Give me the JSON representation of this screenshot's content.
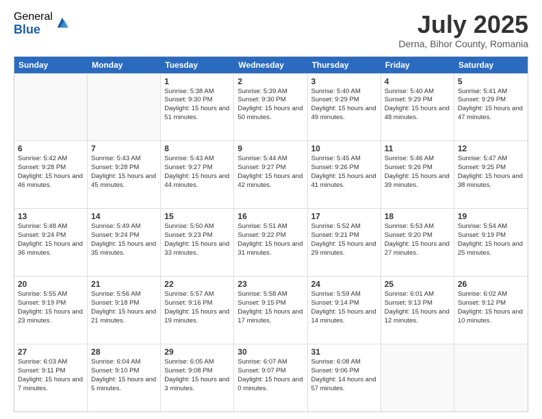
{
  "logo": {
    "general": "General",
    "blue": "Blue"
  },
  "header": {
    "month": "July 2025",
    "location": "Derna, Bihor County, Romania"
  },
  "weekdays": [
    "Sunday",
    "Monday",
    "Tuesday",
    "Wednesday",
    "Thursday",
    "Friday",
    "Saturday"
  ],
  "rows": [
    [
      {
        "day": "",
        "sunrise": "",
        "sunset": "",
        "daylight": ""
      },
      {
        "day": "",
        "sunrise": "",
        "sunset": "",
        "daylight": ""
      },
      {
        "day": "1",
        "sunrise": "Sunrise: 5:38 AM",
        "sunset": "Sunset: 9:30 PM",
        "daylight": "Daylight: 15 hours and 51 minutes."
      },
      {
        "day": "2",
        "sunrise": "Sunrise: 5:39 AM",
        "sunset": "Sunset: 9:30 PM",
        "daylight": "Daylight: 15 hours and 50 minutes."
      },
      {
        "day": "3",
        "sunrise": "Sunrise: 5:40 AM",
        "sunset": "Sunset: 9:29 PM",
        "daylight": "Daylight: 15 hours and 49 minutes."
      },
      {
        "day": "4",
        "sunrise": "Sunrise: 5:40 AM",
        "sunset": "Sunset: 9:29 PM",
        "daylight": "Daylight: 15 hours and 48 minutes."
      },
      {
        "day": "5",
        "sunrise": "Sunrise: 5:41 AM",
        "sunset": "Sunset: 9:29 PM",
        "daylight": "Daylight: 15 hours and 47 minutes."
      }
    ],
    [
      {
        "day": "6",
        "sunrise": "Sunrise: 5:42 AM",
        "sunset": "Sunset: 9:28 PM",
        "daylight": "Daylight: 15 hours and 46 minutes."
      },
      {
        "day": "7",
        "sunrise": "Sunrise: 5:43 AM",
        "sunset": "Sunset: 9:28 PM",
        "daylight": "Daylight: 15 hours and 45 minutes."
      },
      {
        "day": "8",
        "sunrise": "Sunrise: 5:43 AM",
        "sunset": "Sunset: 9:27 PM",
        "daylight": "Daylight: 15 hours and 44 minutes."
      },
      {
        "day": "9",
        "sunrise": "Sunrise: 5:44 AM",
        "sunset": "Sunset: 9:27 PM",
        "daylight": "Daylight: 15 hours and 42 minutes."
      },
      {
        "day": "10",
        "sunrise": "Sunrise: 5:45 AM",
        "sunset": "Sunset: 9:26 PM",
        "daylight": "Daylight: 15 hours and 41 minutes."
      },
      {
        "day": "11",
        "sunrise": "Sunrise: 5:46 AM",
        "sunset": "Sunset: 9:26 PM",
        "daylight": "Daylight: 15 hours and 39 minutes."
      },
      {
        "day": "12",
        "sunrise": "Sunrise: 5:47 AM",
        "sunset": "Sunset: 9:25 PM",
        "daylight": "Daylight: 15 hours and 38 minutes."
      }
    ],
    [
      {
        "day": "13",
        "sunrise": "Sunrise: 5:48 AM",
        "sunset": "Sunset: 9:24 PM",
        "daylight": "Daylight: 15 hours and 36 minutes."
      },
      {
        "day": "14",
        "sunrise": "Sunrise: 5:49 AM",
        "sunset": "Sunset: 9:24 PM",
        "daylight": "Daylight: 15 hours and 35 minutes."
      },
      {
        "day": "15",
        "sunrise": "Sunrise: 5:50 AM",
        "sunset": "Sunset: 9:23 PM",
        "daylight": "Daylight: 15 hours and 33 minutes."
      },
      {
        "day": "16",
        "sunrise": "Sunrise: 5:51 AM",
        "sunset": "Sunset: 9:22 PM",
        "daylight": "Daylight: 15 hours and 31 minutes."
      },
      {
        "day": "17",
        "sunrise": "Sunrise: 5:52 AM",
        "sunset": "Sunset: 9:21 PM",
        "daylight": "Daylight: 15 hours and 29 minutes."
      },
      {
        "day": "18",
        "sunrise": "Sunrise: 5:53 AM",
        "sunset": "Sunset: 9:20 PM",
        "daylight": "Daylight: 15 hours and 27 minutes."
      },
      {
        "day": "19",
        "sunrise": "Sunrise: 5:54 AM",
        "sunset": "Sunset: 9:19 PM",
        "daylight": "Daylight: 15 hours and 25 minutes."
      }
    ],
    [
      {
        "day": "20",
        "sunrise": "Sunrise: 5:55 AM",
        "sunset": "Sunset: 9:19 PM",
        "daylight": "Daylight: 15 hours and 23 minutes."
      },
      {
        "day": "21",
        "sunrise": "Sunrise: 5:56 AM",
        "sunset": "Sunset: 9:18 PM",
        "daylight": "Daylight: 15 hours and 21 minutes."
      },
      {
        "day": "22",
        "sunrise": "Sunrise: 5:57 AM",
        "sunset": "Sunset: 9:16 PM",
        "daylight": "Daylight: 15 hours and 19 minutes."
      },
      {
        "day": "23",
        "sunrise": "Sunrise: 5:58 AM",
        "sunset": "Sunset: 9:15 PM",
        "daylight": "Daylight: 15 hours and 17 minutes."
      },
      {
        "day": "24",
        "sunrise": "Sunrise: 5:59 AM",
        "sunset": "Sunset: 9:14 PM",
        "daylight": "Daylight: 15 hours and 14 minutes."
      },
      {
        "day": "25",
        "sunrise": "Sunrise: 6:01 AM",
        "sunset": "Sunset: 9:13 PM",
        "daylight": "Daylight: 15 hours and 12 minutes."
      },
      {
        "day": "26",
        "sunrise": "Sunrise: 6:02 AM",
        "sunset": "Sunset: 9:12 PM",
        "daylight": "Daylight: 15 hours and 10 minutes."
      }
    ],
    [
      {
        "day": "27",
        "sunrise": "Sunrise: 6:03 AM",
        "sunset": "Sunset: 9:11 PM",
        "daylight": "Daylight: 15 hours and 7 minutes."
      },
      {
        "day": "28",
        "sunrise": "Sunrise: 6:04 AM",
        "sunset": "Sunset: 9:10 PM",
        "daylight": "Daylight: 15 hours and 5 minutes."
      },
      {
        "day": "29",
        "sunrise": "Sunrise: 6:05 AM",
        "sunset": "Sunset: 9:08 PM",
        "daylight": "Daylight: 15 hours and 3 minutes."
      },
      {
        "day": "30",
        "sunrise": "Sunrise: 6:07 AM",
        "sunset": "Sunset: 9:07 PM",
        "daylight": "Daylight: 15 hours and 0 minutes."
      },
      {
        "day": "31",
        "sunrise": "Sunrise: 6:08 AM",
        "sunset": "Sunset: 9:06 PM",
        "daylight": "Daylight: 14 hours and 57 minutes."
      },
      {
        "day": "",
        "sunrise": "",
        "sunset": "",
        "daylight": ""
      },
      {
        "day": "",
        "sunrise": "",
        "sunset": "",
        "daylight": ""
      }
    ]
  ]
}
